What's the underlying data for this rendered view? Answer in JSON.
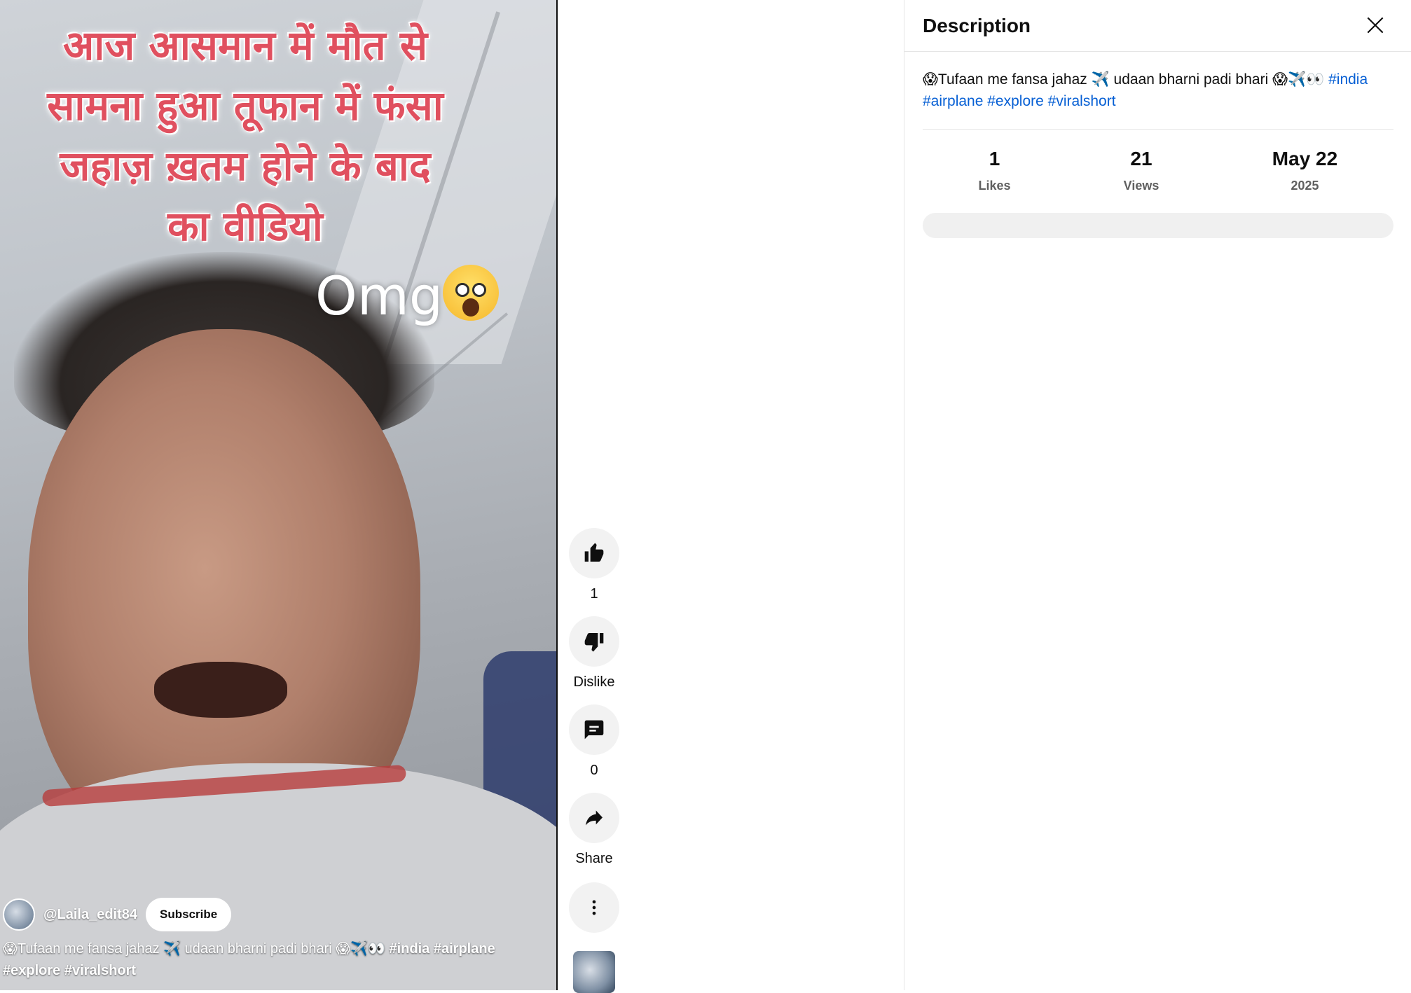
{
  "video": {
    "overlay_lines": [
      "आज आसमान में मौत से",
      "सामना हुआ तूफान में फंसा",
      "जहाज़ ख़तम होने के बाद",
      "का वीडियो"
    ],
    "omg_text": "Omg",
    "channel_name": "@Laila_edit84",
    "subscribe_label": "Subscribe",
    "caption_text": "😱Tufaan me fansa jahaz ✈️ udaan bharni padi bhari 😱✈️👀 ",
    "caption_tags": "#india #airplane #explore #viralshort"
  },
  "actions": {
    "like_count": "1",
    "dislike_label": "Dislike",
    "comment_count": "0",
    "share_label": "Share"
  },
  "panel": {
    "title": "Description",
    "description_text": "😱Tufaan me fansa jahaz ✈️ udaan bharni padi bhari 😱✈️👀 ",
    "hashtags": [
      "#india",
      "#airplane",
      "#explore",
      "#viralshort"
    ],
    "stats": [
      {
        "value": "1",
        "label": "Likes"
      },
      {
        "value": "21",
        "label": "Views"
      },
      {
        "value": "May 22",
        "label": "2025"
      }
    ]
  },
  "colors": {
    "overlay_text": "#e0505f",
    "link": "#065fd4",
    "button_bg": "#f2f2f2"
  },
  "icons": [
    "like-icon",
    "dislike-icon",
    "comment-icon",
    "share-icon",
    "more-vert-icon",
    "close-icon"
  ]
}
